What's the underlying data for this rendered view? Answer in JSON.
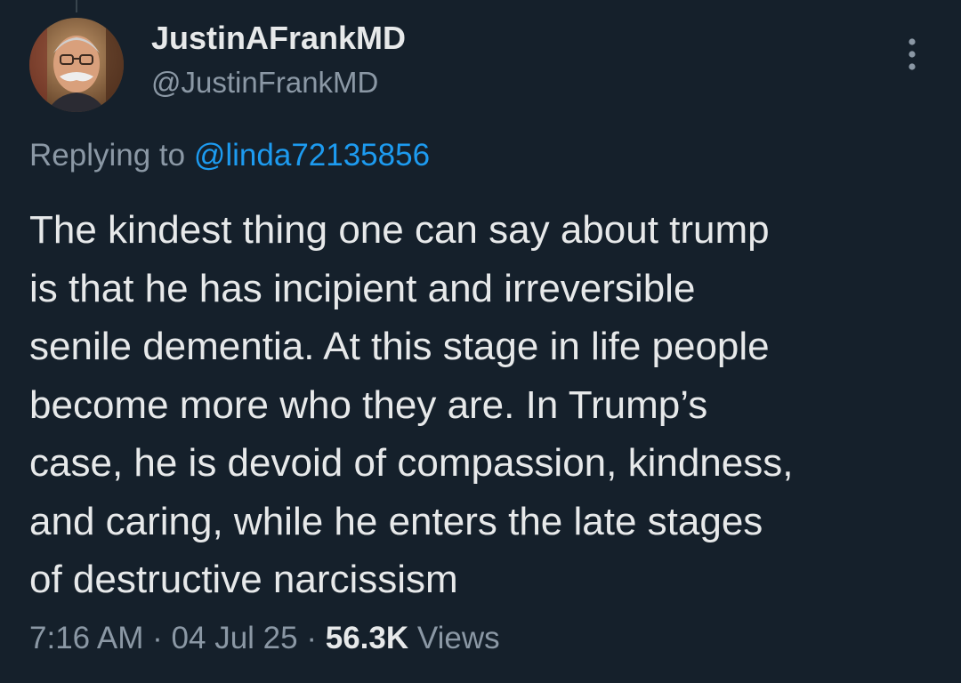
{
  "tweet": {
    "author": {
      "display_name": "JustinAFrankMD",
      "handle": "@JustinFrankMD",
      "avatar_icon": "profile-photo"
    },
    "replying_prefix": "Replying to",
    "replying_to": "@linda72135856",
    "text_lines": [
      "The kindest thing one can say about trump",
      "is that he has incipient and irreversible",
      "senile dementia. At this stage in life people",
      "become more who they are. In Trump’s",
      "case, he is devoid of compassion, kindness,",
      "and caring, while he enters the late stages",
      "of destructive narcissism"
    ],
    "time": "7:16 AM",
    "date": "04 Jul 25",
    "separator": "·",
    "views_count": "56.3K",
    "views_label": "Views",
    "more_icon": "more-vertical-icon"
  },
  "colors": {
    "background": "#15202b",
    "text_primary": "#e7e9ea",
    "text_secondary": "#8b98a5",
    "accent": "#1d9bf0"
  }
}
